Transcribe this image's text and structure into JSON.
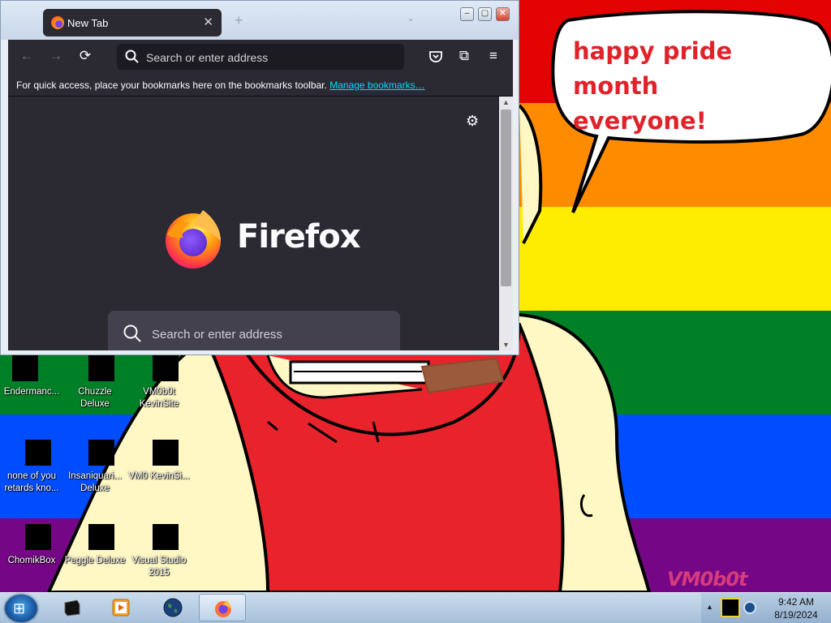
{
  "wallpaper": {
    "stripe_colors": [
      "#e40303",
      "#ff8c00",
      "#ffed00",
      "#008026",
      "#004dff",
      "#750787"
    ],
    "speech_bubble_text": "happy pride month everyone!",
    "watermark": "VM0b0t"
  },
  "desktop_icons": [
    {
      "label": "Endermanc..."
    },
    {
      "label": "Chuzzle Deluxe"
    },
    {
      "label": "VM0b0t KevinSite"
    },
    {
      "label": "none of you retards kno..."
    },
    {
      "label": "Insaniquari... Deluxe"
    },
    {
      "label": "VM0 KevinSi..."
    },
    {
      "label": "ChomikBox"
    },
    {
      "label": "Peggle Deluxe"
    },
    {
      "label": "Visual Studio 2015"
    }
  ],
  "browser": {
    "tab_title": "New Tab",
    "tab_close": "✕",
    "new_tab": "+",
    "address_placeholder": "Search or enter address",
    "bookmarks_message": "For quick access, place your bookmarks here on the bookmarks toolbar.",
    "manage_bookmarks": "Manage bookmarks…",
    "brand": "Firefox",
    "content_search_placeholder": "Search or enter address",
    "toolbar_icons": [
      "back-icon",
      "forward-icon",
      "reload-icon",
      "pocket-icon",
      "extensions-icon",
      "menu-icon"
    ]
  },
  "taskbar": {
    "pinned": [
      "terminal",
      "media-player",
      "globe",
      "firefox"
    ],
    "active_app": "firefox",
    "time": "9:42 AM",
    "date": "8/19/2024"
  }
}
